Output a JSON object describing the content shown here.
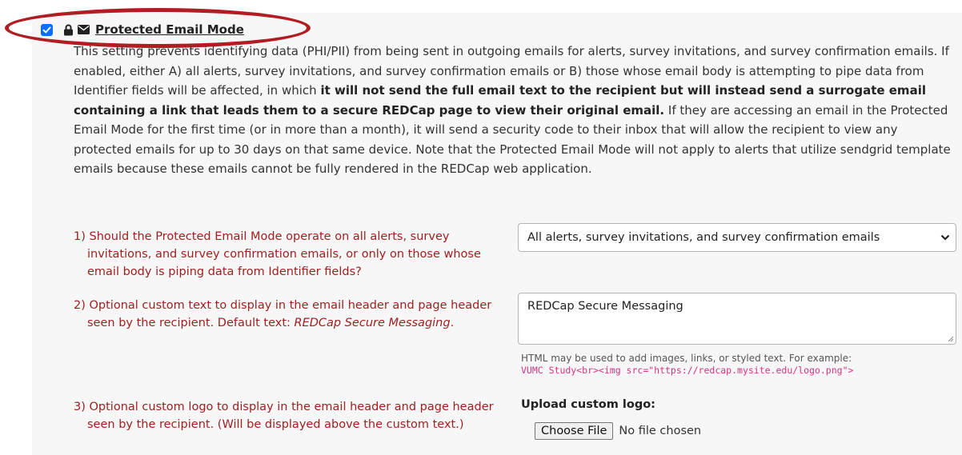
{
  "header": {
    "checkbox_checked": true,
    "title": "Protected Email Mode",
    "icons": [
      "lock-icon",
      "envelope-icon"
    ]
  },
  "description": {
    "lead": "This setting prevents identifying data (PHI/PII) from being sent in outgoing emails for alerts, survey invitations, and survey confirmation emails. If enabled, either A) all alerts, survey invitations, and survey confirmation emails or B) those whose email body is attempting to pipe data from Identifier fields will be affected, in which ",
    "bold": "it will not send the full email text to the recipient but will instead send a surrogate email containing a link that leads them to a secure REDCap page to view their original email.",
    "tail": " If they are accessing an email in the Protected Email Mode for the first time (or in more than a month), it will send a security code to their inbox that will allow the recipient to view any protected emails for up to 30 days on that same device. Note that the Protected Email Mode will not apply to alerts that utilize sendgrid template emails because these emails cannot be fully rendered in the REDCap web application."
  },
  "questions": {
    "q1": {
      "text": "1) Should the Protected Email Mode operate on all alerts, survey invitations, and survey confirmation emails, or only on those whose email body is piping data from Identifier fields?",
      "selected_value": "All alerts, survey invitations, and survey confirmation emails"
    },
    "q2": {
      "text": "2) Optional custom text to display in the email header and page header seen by the recipient. Default text: ",
      "default_text": "REDCap Secure Messaging",
      "suffix": ".",
      "value": "REDCap Secure Messaging",
      "hint": "HTML may be used to add images, links, or styled text. For example:",
      "example_code": "VUMC Study<br><img src=\"https://redcap.mysite.edu/logo.png\">"
    },
    "q3": {
      "text": "3) Optional custom logo to display in the email header and page header seen by the recipient. (Will be displayed above the custom text.)",
      "upload_label": "Upload custom logo:",
      "file_button": "Choose File",
      "file_status": "No file chosen"
    }
  },
  "colors": {
    "question_text": "#a02020",
    "highlight_ellipse": "#b01e23",
    "checkbox": "#0d6efd",
    "code": "#d63384"
  }
}
